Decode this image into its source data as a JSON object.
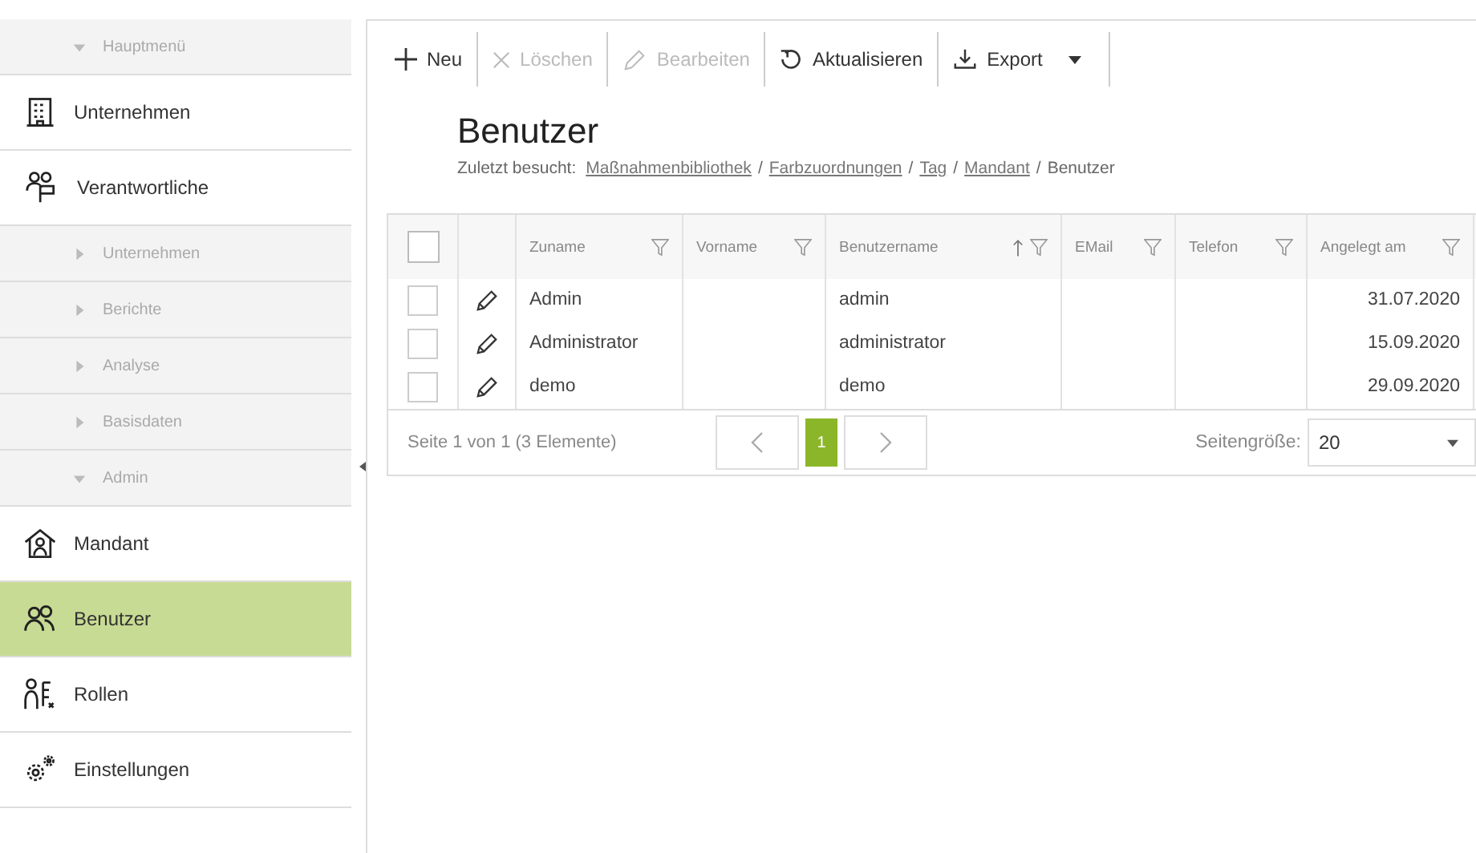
{
  "sidebar": {
    "groups": [
      {
        "label": "Hauptmenü",
        "expanded": true,
        "children": [
          {
            "label": "Unternehmen",
            "selected": false
          },
          {
            "label": "Verantwortliche",
            "selected": false
          }
        ]
      },
      {
        "label": "Unternehmen",
        "expanded": false
      },
      {
        "label": "Berichte",
        "expanded": false
      },
      {
        "label": "Analyse",
        "expanded": false
      },
      {
        "label": "Basisdaten",
        "expanded": false
      },
      {
        "label": "Admin",
        "expanded": true,
        "children": [
          {
            "label": "Mandant",
            "selected": false
          },
          {
            "label": "Benutzer",
            "selected": true
          },
          {
            "label": "Rollen",
            "selected": false
          },
          {
            "label": "Einstellungen",
            "selected": false
          }
        ]
      }
    ]
  },
  "toolbar": {
    "buttons": [
      {
        "label": "Neu",
        "disabled": false
      },
      {
        "label": "Löschen",
        "disabled": true
      },
      {
        "label": "Bearbeiten",
        "disabled": true
      },
      {
        "label": "Aktualisieren",
        "disabled": false
      },
      {
        "label": "Export",
        "disabled": false,
        "dropdown": true
      }
    ]
  },
  "page": {
    "title": "Benutzer",
    "breadcrumb_label": "Zuletzt besucht:",
    "breadcrumb": [
      {
        "label": "Maßnahmenbibliothek",
        "link": true
      },
      {
        "label": "Farbzuordnungen",
        "link": true,
        "separator": "/"
      },
      {
        "label": "Tag",
        "link": true,
        "separator": "/"
      },
      {
        "label": "Mandant",
        "link": true,
        "separator": "/"
      },
      {
        "label": "Benutzer",
        "link": false,
        "separator": "/"
      }
    ]
  },
  "table": {
    "all_selected": false,
    "columns": [
      {
        "label": "Zuname",
        "filter": true,
        "sorted": false
      },
      {
        "label": "Vorname",
        "filter": true,
        "sorted": false
      },
      {
        "label": "Benutzername",
        "filter": true,
        "sorted": true
      },
      {
        "label": "EMail",
        "filter": true,
        "sorted": false
      },
      {
        "label": "Telefon",
        "filter": true,
        "sorted": false
      },
      {
        "label": "Angelegt am",
        "filter": true,
        "sorted": false
      }
    ],
    "rows": [
      {
        "selected": false,
        "zuname": "Admin",
        "benutzername": "admin",
        "angelegt_am": "31.07.2020"
      },
      {
        "selected": false,
        "zuname": "Administrator",
        "benutzername": "administrator",
        "angelegt_am": "15.09.2020"
      },
      {
        "selected": false,
        "zuname": "demo",
        "benutzername": "demo",
        "angelegt_am": "29.09.2020"
      }
    ]
  },
  "pager": {
    "summary": "Seite 1 von 1 (3 Elemente)",
    "pages": [
      {
        "label": "1",
        "selected": true
      }
    ],
    "page_size_label": "Seitengröße:",
    "page_size": "20"
  }
}
